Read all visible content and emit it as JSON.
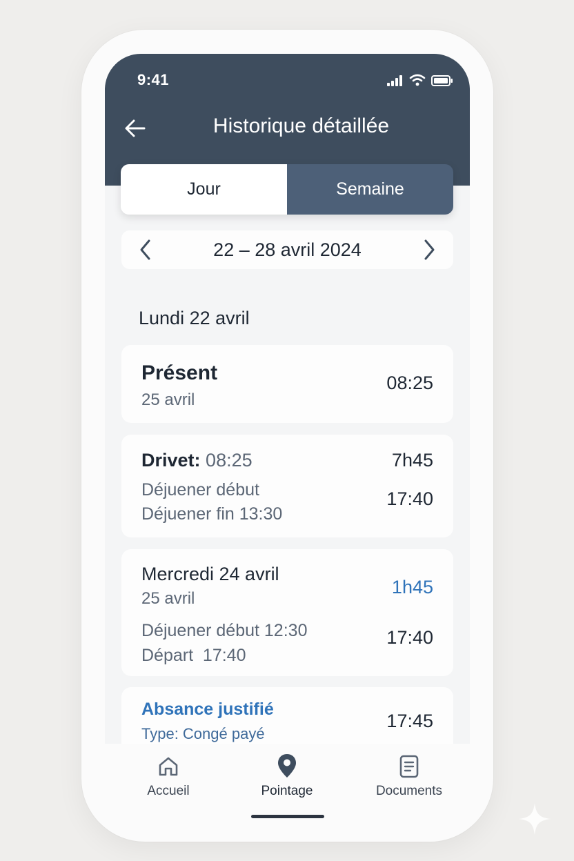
{
  "status_bar": {
    "time": "9:41"
  },
  "header": {
    "title": "Historique détaillée"
  },
  "tabs": [
    {
      "label": "Jour",
      "active": true
    },
    {
      "label": "Semaine",
      "active": false
    }
  ],
  "date_range": {
    "label": "22 – 28 avril 2024"
  },
  "day_heading": "Lundi 22 avril",
  "cards": {
    "present": {
      "title": "Présent",
      "subtitle": "25 avril",
      "time": "08:25"
    },
    "drivet": {
      "name": "Drivet:",
      "arrival": "08:25",
      "duration": "7h45",
      "lunch_start": "Déjuener début",
      "lunch_end": "Déjuener fin 13:30",
      "end_time": "17:40"
    },
    "wednesday": {
      "title": "Mercredi 24 avril",
      "subtitle": "25 avril",
      "duration": "1h45",
      "lunch_start": "Déjuener début 12:30",
      "departure": "Départ  17:40",
      "end_time": "17:40"
    },
    "absence": {
      "title": "Absance justifié",
      "type": "Type: Congé payé",
      "time": "17:45"
    }
  },
  "bottom_nav": [
    {
      "label": "Accueil",
      "icon": "home-icon"
    },
    {
      "label": "Pointage",
      "icon": "location-pin-icon"
    },
    {
      "label": "Documents",
      "icon": "document-icon"
    }
  ],
  "colors": {
    "header": "#3e4d5e",
    "active_tab": "#ffffff",
    "inactive_tab": "#4d6078",
    "accent_blue": "#2f73b9",
    "background": "#f4f5f6"
  }
}
